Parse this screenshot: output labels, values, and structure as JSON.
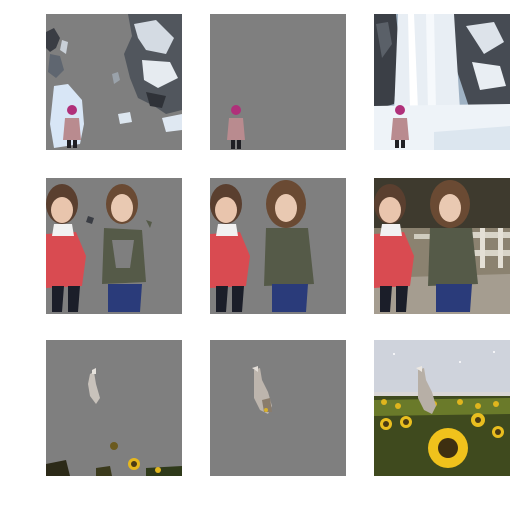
{
  "grid": {
    "rows": 3,
    "columns": [
      "mask-a",
      "mask-b",
      "original"
    ],
    "row_subjects": [
      "waterfall-person",
      "two-girls",
      "bird-sunflowers"
    ]
  },
  "colors": {
    "mask_gray": "#7f7f7f",
    "background": "#ffffff"
  }
}
